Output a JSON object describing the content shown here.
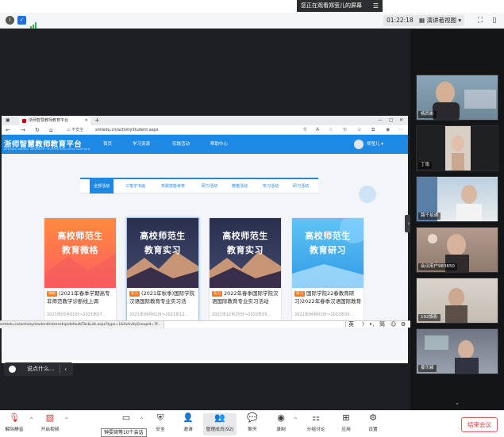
{
  "banner": {
    "viewing": "您正在观看郑莹儿的屏幕"
  },
  "meeting": {
    "timer": "01:22:18",
    "view_mode": "演讲者视图"
  },
  "browser": {
    "tab_title": "浙师智慧教师教育平台",
    "security": "不安全",
    "url": "smtedu.cn/activityStudent.aspx",
    "status_url": "smtedu.cn/activity/student/internship/default/TaskList.aspx?type=1&ActivityGroupId=7f..."
  },
  "site": {
    "logo": "浙师智慧教师教育平台",
    "logo_sub": "ZHEJIANG NORMAL UNIVERSITY TEACHER EDUCATION PLATFORM",
    "nav": [
      "首页",
      "学习资源",
      "实践活动",
      "帮助中心"
    ],
    "user": "郑莹儿 ▾",
    "categories": [
      "全部活动",
      "三笔字书画",
      "实践技能考核",
      "研习活动",
      "微格活动",
      "实习活动",
      "研习活动"
    ],
    "cards": [
      {
        "cover": "高校师范生\n教育微格",
        "badge": "微格",
        "title": "(2021年春季学期高专非师范教学诊断线上调",
        "date": "2021年03月01日～2021年07..."
      },
      {
        "cover": "高校师范生\n教育实习",
        "badge": "实习",
        "title": "(2021年秋季)国际学院汉语国际教育专业实习活",
        "date": "2021年09月01日～2021年12..."
      },
      {
        "cover": "高校师范生\n教育实习",
        "badge": "实习",
        "title": "2022年春季国际学院汉语国际教育专业实习活动",
        "date": "2021年12月25日～2022年05..."
      },
      {
        "cover": "高校师范生\n教育研习",
        "badge": "研习",
        "title": "国际学院22春教育研习)2022年春季汉语国际教育",
        "date": "2022年04月01日～2022年05..."
      }
    ]
  },
  "ime": {
    "lang": "英"
  },
  "chat": {
    "placeholder": "说点什么..."
  },
  "participants": [
    "杨西彬",
    "丁雨",
    "路千拾通",
    "会议用户983650",
    "192族影",
    "姜乐颖"
  ],
  "toolbar": {
    "unmute": "解除静音",
    "video": "开启视频",
    "share": "共享屏幕",
    "security": "安全",
    "invite": "邀请",
    "manage": "管理成员(92)",
    "chat": "聊天",
    "record": "录制",
    "breakout": "分组讨论",
    "apps": "应用",
    "settings": "设置",
    "end": "结束会议",
    "tooltip": "钟雯琦等10个会话"
  },
  "colors": {
    "brand": "#1e88e5",
    "end": "#e03a3a"
  }
}
